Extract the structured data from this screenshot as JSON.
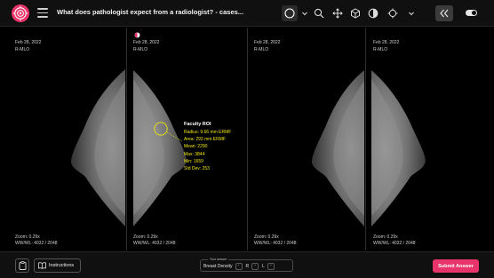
{
  "header": {
    "title": "What does pathologist expect from a radiologist? - cases...",
    "tools": [
      {
        "icon": "circle-roi-icon",
        "selected": true
      },
      {
        "icon": "chevron-down-icon"
      },
      {
        "icon": "zoom-icon"
      },
      {
        "icon": "pan-move-icon"
      },
      {
        "icon": "cube-3d-icon"
      },
      {
        "icon": "contrast-icon"
      },
      {
        "icon": "reset-icon"
      },
      {
        "icon": "chevron-down-icon"
      },
      {
        "icon": "collapse-chevrons-icon",
        "selected": true
      },
      {
        "icon": "toggle-icon"
      }
    ]
  },
  "viewports": [
    {
      "date": "Feb 28, 2022",
      "view": "R-MLO",
      "zoom": "Zoom: 0.29x",
      "wwwl": "WW/WL: 4032 / 2048",
      "icon": "none"
    },
    {
      "date": "Feb 28, 2022",
      "view": "R-MLO",
      "zoom": "Zoom: 0.29x",
      "wwwl": "WW/WL: 4032 / 2048",
      "icon": "contrast-half-icon"
    },
    {
      "date": "Feb 28, 2022",
      "view": "R-MLO",
      "zoom": "Zoom: 0.29x",
      "wwwl": "WW/WL: 4032 / 2048",
      "icon": "none"
    },
    {
      "date": "Feb 28, 2022",
      "view": "R-MLO",
      "zoom": "Zoom: 0.29x",
      "wwwl": "WW/WL: 4032 / 2048",
      "icon": "none"
    }
  ],
  "roi": {
    "title": "Faculty ROI",
    "radius": "Radius: 9.66 mm ERMF",
    "area": "Area: 293 mm ERMF",
    "mean": "Mean: 2290",
    "max": "Max: 3844",
    "min": "Min: 1659",
    "std": "Std Dev: 253",
    "color": "#f1e60e"
  },
  "footer": {
    "instructions_label": "Instructions",
    "answer_caption": "Your answer",
    "answer_label": "Breast Density",
    "answer_r": "R",
    "answer_l": "L",
    "minus": "-",
    "submit_label": "Submit Answer",
    "accent_color": "#e8336b"
  }
}
